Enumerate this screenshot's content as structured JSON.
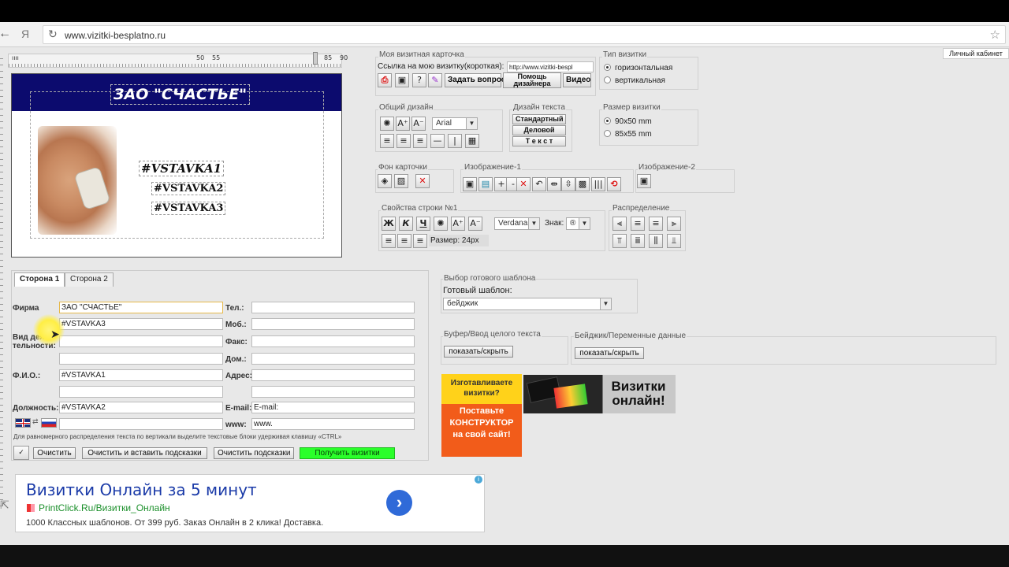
{
  "browser": {
    "url": "www.vizitki-besplatno.ru",
    "back_glyph": "←",
    "yandex_glyph": "Я"
  },
  "ruler": {
    "ticks": [
      "50",
      "55",
      "85",
      "90"
    ]
  },
  "card": {
    "firm": "ЗАО \"СЧАСТЬЕ\"",
    "line1": "#VSTAVKA1",
    "line2": "#VSTAVKA2",
    "line3": "#VSTAVKA3"
  },
  "panels": {
    "my_card": {
      "title": "Моя визитная карточка",
      "short_link_label": "Ссылка на мою визитку(короткая):",
      "short_link_value": "http://www.vizitki-bespl",
      "ask_button": "Задать вопрос",
      "designer_help_button_line1": "Помощь",
      "designer_help_button_line2": "дизайнера",
      "video_button": "Видео"
    },
    "card_type": {
      "title": "Тип визитки",
      "options": [
        "горизонтальная",
        "вертикальная"
      ],
      "selected": "горизонтальная"
    },
    "general_design": {
      "title": "Общий дизайн",
      "font": "Arial"
    },
    "text_design": {
      "title": "Дизайн текста",
      "options": [
        "Стандартный",
        "Деловой",
        "Т е к с т"
      ]
    },
    "card_size": {
      "title": "Размер визитки",
      "options": [
        "90x50 mm",
        "85x55 mm"
      ],
      "selected": "90x50 mm"
    },
    "background": {
      "title": "Фон карточки"
    },
    "image1": {
      "title": "Изображение-1"
    },
    "image2": {
      "title": "Изображение-2"
    },
    "line_props": {
      "title": "Свойства строки №1",
      "font": "Verdana",
      "sign_label": "Знак:",
      "sign_value": "®",
      "size_label": "Размер: 24px"
    },
    "distribution": {
      "title": "Распределение"
    }
  },
  "personal": {
    "label": "Личный кабинет"
  },
  "form": {
    "tabs": [
      "Сторона 1",
      "Сторона 2"
    ],
    "labels": {
      "firm": "Фирма",
      "activity": "Вид дея-\nтельности:",
      "fio": "Ф.И.О.:",
      "position": "Должность:",
      "tel": "Тел.:",
      "mob": "Моб.:",
      "fax": "Факс:",
      "home": "Дом.:",
      "address": "Адрес:",
      "email": "E-mail:",
      "www": "www:"
    },
    "values": {
      "firm": "ЗАО \"СЧАСТЬЕ\"",
      "activity1": "#VSTAVKA3",
      "fio": "#VSTAVKA1",
      "position": "#VSTAVKA2",
      "email": "E-mail:",
      "www": "www."
    },
    "hint": "Для равномерного распределения текста по вертикали выделите текстовые блоки удерживая клавишу «CTRL»",
    "buttons": {
      "clear": "Очистить",
      "clear_insert": "Очистить и вставить подсказки",
      "clear_hints": "Очистить подсказки",
      "get_cards": "Получить визитки"
    }
  },
  "template": {
    "title": "Выбор готового шаблона",
    "label": "Готовый шаблон:",
    "value": "бейджик"
  },
  "buffer": {
    "title": "Буфер/Ввод целого текста",
    "button": "показать/скрыть"
  },
  "badge": {
    "title": "Бейджик/Переменные данные",
    "button": "показать/скрыть"
  },
  "promo": {
    "left_top": "Изготавливаете визитки?",
    "left_bottom": "Поставьте КОНСТРУКТОР на свой сайт!",
    "right": "Визитки онлайн!"
  },
  "ad": {
    "title": "Визитки Онлайн за 5 минут",
    "domain": "PrintClick.Ru/Визитки_Онлайн",
    "description": "1000 Классных шаблонов. От 399 руб. Заказ Онлайн в 2 клика! Доставка."
  },
  "colors": {
    "card_band": "#0c0b6e",
    "get_button": "#2aff2a",
    "ad_title": "#1a3aa8",
    "ad_domain": "#1a8f2a",
    "promo_orange": "#f25c1a",
    "promo_yellow": "#ffd21a"
  }
}
